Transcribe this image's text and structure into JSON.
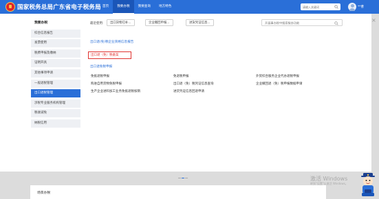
{
  "header": {
    "site_title": "国家税务总局广东省电子税务局",
    "nav": [
      "首页",
      "我要办税",
      "我要查询",
      "地方特色"
    ],
    "search_placeholder": "请输入关键词",
    "user_name": "**曹",
    "brand_color": "#2a6fd8"
  },
  "sidebar": {
    "title": "我要办税",
    "items": [
      "综合信息报告",
      "发票使用",
      "税费申报及缴纳",
      "证明开具",
      "其他事项申请",
      "一般退税管理",
      "出口退税管理",
      "涉税专业服务机构管理",
      "税收减免",
      "纳税信用"
    ],
    "active_index": 6
  },
  "content": {
    "common_label": "最近使用:",
    "common_chips": [
      "出口货物已补...",
      "企业撤回申报...",
      "进货凭证信息..."
    ],
    "search_placeholder": "开展事办税中搜索服务功能",
    "sections": [
      {
        "title": "出口退(免)税企业资格信息报告",
        "links": [
          "出口退（免）税备案"
        ]
      },
      {
        "title": "出口退免税申报",
        "links": [
          "免抵退税申报",
          "免退税申报",
          "外贸综合服务企业代办退税申报",
          "购进自用货物免税申报",
          "出口退（免）税凭证信息查询",
          "企业撤回退（免）税申报数据申请",
          "生产企业进料加工业务免抵退税核销",
          "进货凭证信息回退申请"
        ]
      }
    ],
    "highlight_color": "#e0312e"
  },
  "bottom": {
    "scene_title": "场景办税",
    "watermark_line1": "激活 Windows",
    "watermark_line2": "转到\"设置\"以激活 Windows。"
  },
  "icons": [
    "search-icon",
    "close-icon",
    "avatar-icon",
    "tax-emblem-icon",
    "mascot-icon"
  ]
}
